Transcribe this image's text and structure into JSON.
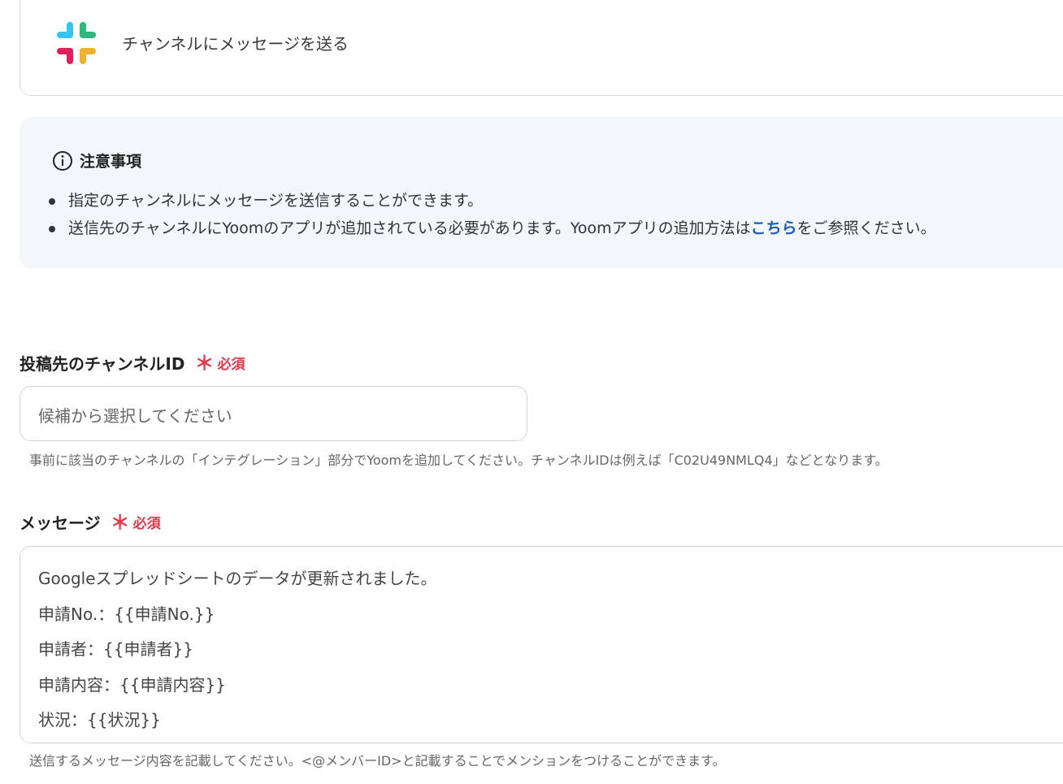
{
  "header": {
    "icon": "slack-icon",
    "title": "チャンネルにメッセージを送る"
  },
  "notice": {
    "icon": "info-icon",
    "title": "注意事項",
    "item1": "指定のチャンネルにメッセージを送信することができます。",
    "item2_before": "送信先のチャンネルにYoomのアプリが追加されている必要があります。Yoomアプリの追加方法は",
    "item2_link": "こちら",
    "item2_after": "をご参照ください。"
  },
  "channel_field": {
    "label": "投稿先のチャンネルID",
    "required_mark": "＊",
    "required_label": "必須",
    "placeholder": "候補から選択してください",
    "helper": "事前に該当のチャンネルの「インテグレーション」部分でYoomを追加してください。チャンネルIDは例えば「C02U49NMLQ4」などとなります。"
  },
  "message_field": {
    "label": "メッセージ",
    "required_mark": "＊",
    "required_label": "必須",
    "lines": [
      "Googleスプレッドシートのデータが更新されました。",
      "申請No.：{{申請No.}}",
      "申請者：{{申請者}}",
      "申請内容：{{申請内容}}",
      "状況：{{状況}}"
    ],
    "helper": "送信するメッセージ内容を記載してください。<@メンバーID>と記載することでメンションをつけることができます。"
  },
  "colors": {
    "required": "#e0384a",
    "link": "#1a5fb4",
    "notice_bg": "#f3f6fa"
  }
}
